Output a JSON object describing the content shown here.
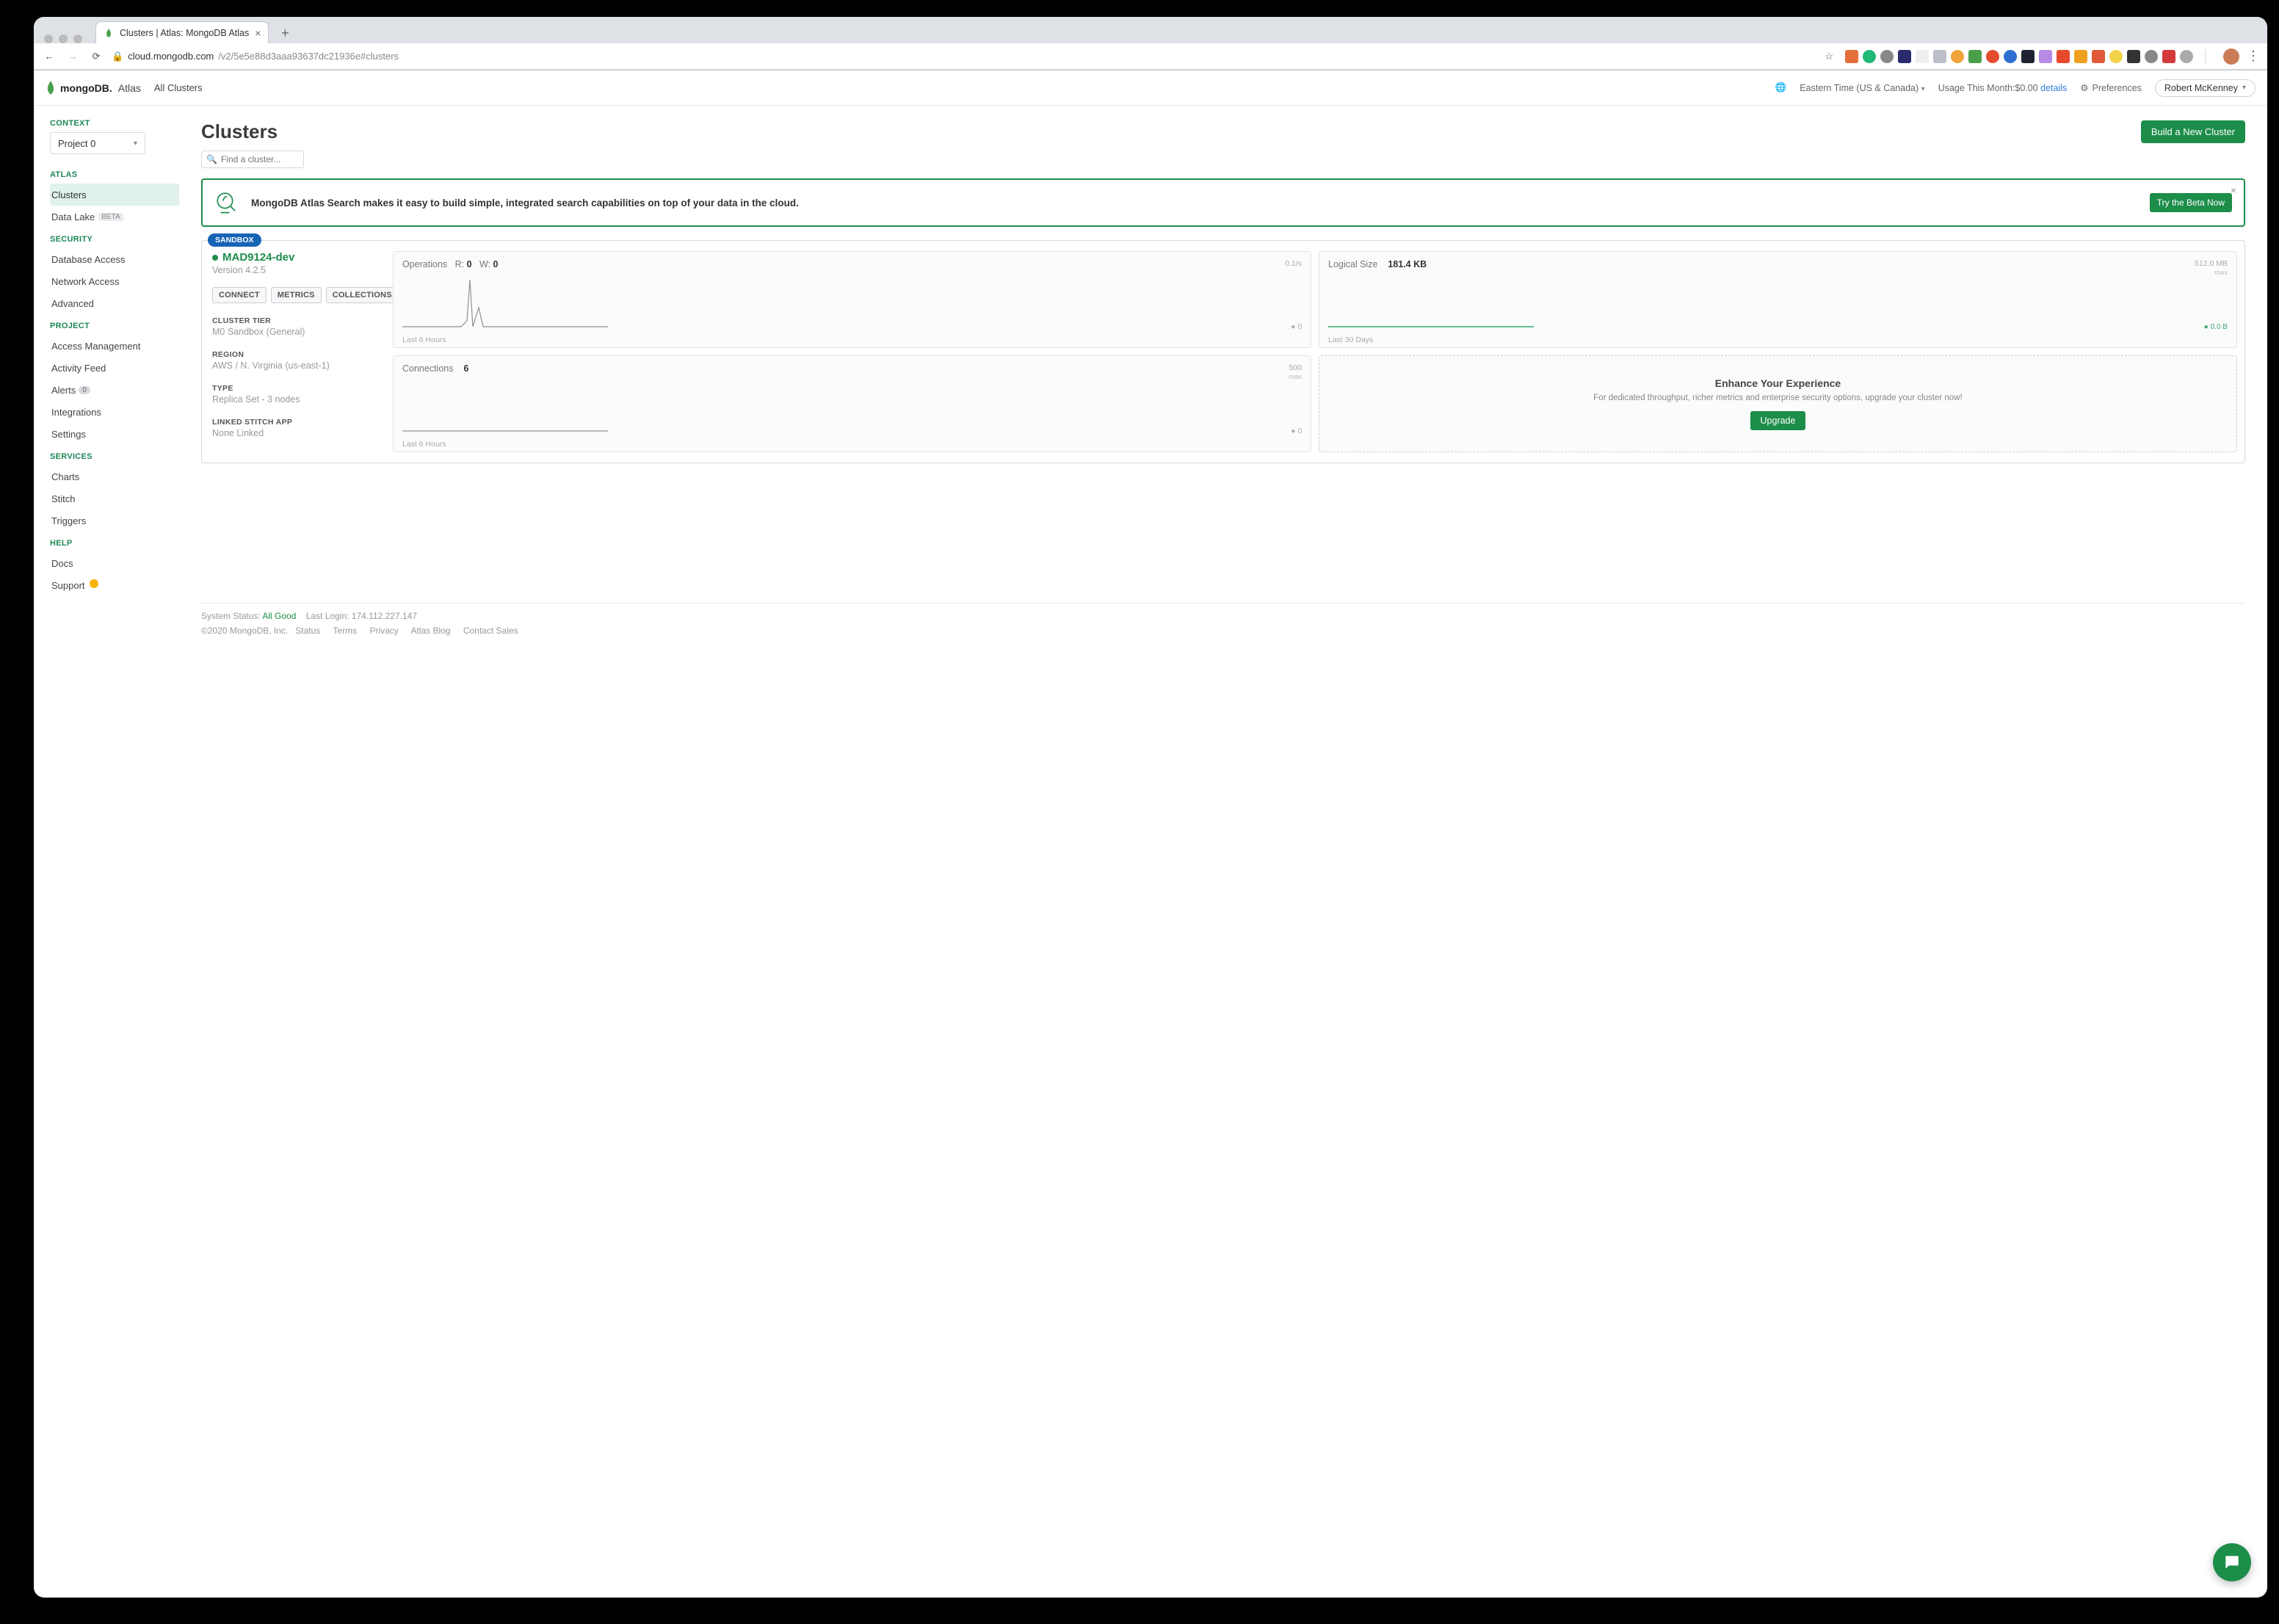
{
  "browser": {
    "tab_title": "Clusters | Atlas: MongoDB Atlas",
    "url_host": "cloud.mongodb.com",
    "url_path": "/v2/5e5e88d3aaa93637dc21936e#clusters"
  },
  "header": {
    "brand_main": "mongoDB.",
    "brand_sub": "Atlas",
    "all_clusters": "All Clusters",
    "timezone": "Eastern Time (US & Canada)",
    "usage_label": "Usage This Month:",
    "usage_amount": "$0.00",
    "details": "details",
    "preferences": "Preferences",
    "user_name": "Robert McKenney"
  },
  "sidebar": {
    "context_label": "CONTEXT",
    "project_name": "Project 0",
    "sections": {
      "atlas_label": "ATLAS",
      "atlas_items": [
        "Clusters",
        "Data Lake"
      ],
      "atlas_beta": "BETA",
      "security_label": "SECURITY",
      "security_items": [
        "Database Access",
        "Network Access",
        "Advanced"
      ],
      "project_label": "PROJECT",
      "project_items": [
        "Access Management",
        "Activity Feed",
        "Alerts",
        "Integrations",
        "Settings"
      ],
      "alerts_badge": "0",
      "services_label": "SERVICES",
      "services_items": [
        "Charts",
        "Stitch",
        "Triggers"
      ],
      "help_label": "HELP",
      "help_items": [
        "Docs",
        "Support"
      ]
    }
  },
  "main": {
    "title": "Clusters",
    "build_button": "Build a New Cluster",
    "search_placeholder": "Find a cluster...",
    "banner_text": "MongoDB Atlas Search makes it easy to build simple, integrated search capabilities on top of your data in the cloud.",
    "banner_button": "Try the Beta Now"
  },
  "cluster": {
    "badge": "SANDBOX",
    "name": "MAD9124-dev",
    "version": "Version 4.2.5",
    "buttons": {
      "connect": "CONNECT",
      "metrics": "METRICS",
      "collections": "COLLECTIONS"
    },
    "tier_label": "CLUSTER TIER",
    "tier_value": "M0 Sandbox (General)",
    "region_label": "REGION",
    "region_value": "AWS / N. Virginia (us-east-1)",
    "type_label": "TYPE",
    "type_value": "Replica Set - 3 nodes",
    "stitch_label": "LINKED STITCH APP",
    "stitch_value": "None Linked"
  },
  "charts": {
    "ops": {
      "title": "Operations",
      "r_label": "R:",
      "r_val": "0",
      "w_label": "W:",
      "w_val": "0",
      "scale": "0.1/s",
      "end": "0",
      "footer": "Last 6 Hours"
    },
    "size": {
      "title": "Logical Size",
      "value": "181.4 KB",
      "scale": "512.0 MB",
      "scale_sub": "max",
      "end": "0.0 B",
      "footer": "Last 30 Days"
    },
    "conn": {
      "title": "Connections",
      "value": "6",
      "scale": "500",
      "scale_sub": "max",
      "end": "0",
      "footer": "Last 6 Hours"
    },
    "upgrade": {
      "title": "Enhance Your Experience",
      "desc": "For dedicated throughput, richer metrics and enterprise security options, upgrade your cluster now!",
      "button": "Upgrade"
    }
  },
  "footer": {
    "status_label": "System Status:",
    "status_value": "All Good",
    "login_label": "Last Login:",
    "login_value": "174.112.227.147",
    "copyright": "©2020 MongoDB, Inc.",
    "links": [
      "Status",
      "Terms",
      "Privacy",
      "Atlas Blog",
      "Contact Sales"
    ]
  }
}
